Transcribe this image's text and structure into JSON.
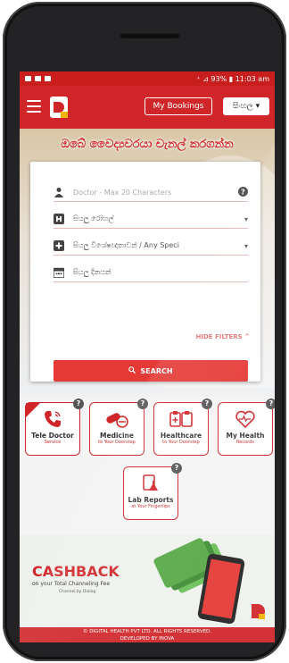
{
  "statusbar": {
    "right": "⁺ ⊿ 93% ▮ 11:03 am"
  },
  "header": {
    "bookings_label": "My Bookings",
    "language_label": "සිංහල"
  },
  "hero": {
    "title": "ඔබේ වෛද්‍යවරයා චැනල් කරගන්න"
  },
  "search": {
    "doctor_placeholder": "Doctor - Max 20 Characters",
    "hospital_label": "සියලු රෝහල්",
    "specialization_label": "සියලු විශේෂඥතාවන් / Any Speci",
    "date_label": "සියලු දිනයන්",
    "hide_filters_label": "HIDE FILTERS",
    "search_button_label": "SEARCH"
  },
  "tiles": [
    {
      "title": "Tele Doctor",
      "subtitle": "Service"
    },
    {
      "title": "Medicine",
      "subtitle": "to Your Doorstep"
    },
    {
      "title": "Healthcare",
      "subtitle": "to Your Doorstep"
    },
    {
      "title": "My Health",
      "subtitle": "Records"
    },
    {
      "title": "Lab Reports",
      "subtitle": "at Your Fingertips"
    }
  ],
  "banner": {
    "headline": "CASHBACK",
    "subtitle": "on your Total Channeling Fee",
    "brand": "Channel by Dialog"
  },
  "footer": {
    "line1": "© DIGITAL HEALTH PVT LTD. ALL RIGHTS RESERVED.",
    "line2": "DEVELOPED BY INOVA"
  },
  "colors": {
    "brand": "#d0262a",
    "accent": "#e53935"
  },
  "icons": [
    "menu-icon",
    "app-logo",
    "person-icon",
    "hospital-icon",
    "plus-icon",
    "calendar-icon",
    "help-icon",
    "search-icon",
    "phone-icon",
    "pill-icon",
    "clipboard-icon",
    "heart-icon",
    "flask-icon"
  ]
}
